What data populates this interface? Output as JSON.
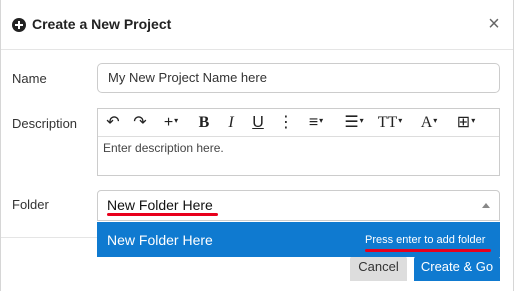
{
  "dialog": {
    "title": "Create a New Project",
    "close_label": "×"
  },
  "form": {
    "name_label": "Name",
    "name_placeholder": "My New Project Name here",
    "description_label": "Description",
    "description_placeholder": "Enter description here.",
    "folder_label": "Folder",
    "folder_value": "New Folder Here"
  },
  "toolbar": {
    "undo": "↶",
    "redo": "↷",
    "insert": "+",
    "bold": "B",
    "italic": "I",
    "underline": "U",
    "more": "⋮",
    "align": "≡",
    "list": "☰",
    "text_size": "TT",
    "font_color": "A",
    "table": "⊞",
    "caret": "▾"
  },
  "dropdown": {
    "option_label": "New Folder Here",
    "hint": "Press enter to add folder"
  },
  "footer": {
    "cancel_label": "Cancel",
    "create_label": "Create & Go"
  },
  "colors": {
    "accent": "#0f7ad0",
    "annotation_red": "#e8001c"
  }
}
